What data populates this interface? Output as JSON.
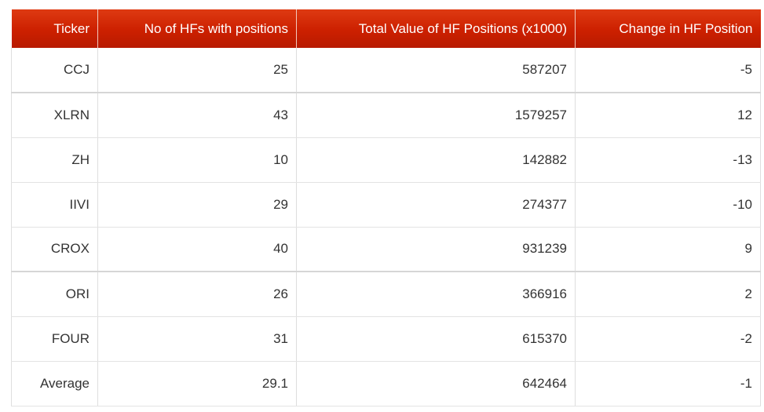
{
  "table": {
    "headers": [
      "Ticker",
      "No of HFs with positions",
      "Total Value of HF Positions (x1000)",
      "Change in HF Position"
    ],
    "rows": [
      [
        "CCJ",
        "25",
        "587207",
        "-5"
      ],
      [
        "XLRN",
        "43",
        "1579257",
        "12"
      ],
      [
        "ZH",
        "10",
        "142882",
        "-13"
      ],
      [
        "IIVI",
        "29",
        "274377",
        "-10"
      ],
      [
        "CROX",
        "40",
        "931239",
        "9"
      ],
      [
        "ORI",
        "26",
        "366916",
        "2"
      ],
      [
        "FOUR",
        "31",
        "615370",
        "-2"
      ],
      [
        "Average",
        "29.1",
        "642464",
        "-1"
      ]
    ],
    "header_color": "#cc2000"
  }
}
